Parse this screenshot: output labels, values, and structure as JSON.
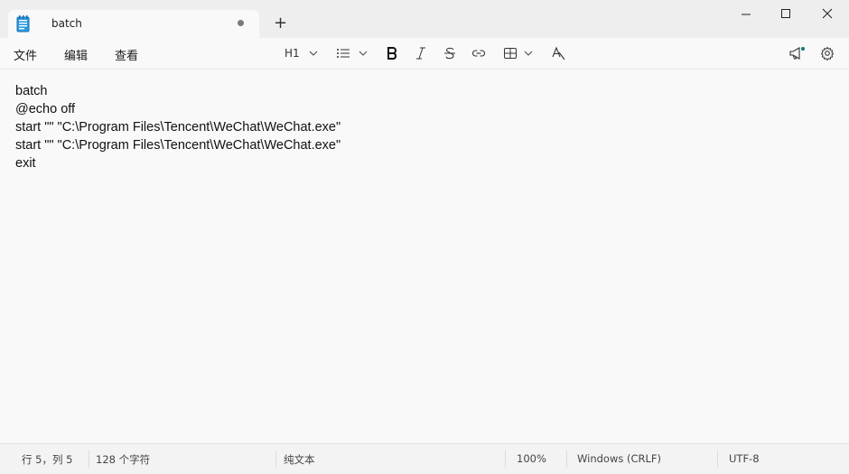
{
  "window": {
    "tab_title": "batch",
    "tab_unsaved": true,
    "new_tab_symbol": "+"
  },
  "menu": {
    "file": "文件",
    "edit": "编辑",
    "view": "查看"
  },
  "toolbar": {
    "heading_label": "H1",
    "icons": [
      "heading-dropdown",
      "list-icon",
      "bold-icon",
      "italic-icon",
      "strikethrough-icon",
      "link-icon",
      "table-icon",
      "clear-format-icon",
      "announcement-icon",
      "settings-icon"
    ]
  },
  "editor": {
    "lines": [
      "batch",
      "@echo off",
      "start \"\" \"C:\\Program Files\\Tencent\\WeChat\\WeChat.exe\"",
      "start \"\" \"C:\\Program Files\\Tencent\\WeChat\\WeChat.exe\"",
      "exit"
    ]
  },
  "status": {
    "position": "行 5，列 5",
    "char_count": "128 个字符",
    "format": "纯文本",
    "zoom": "100%",
    "line_ending": "Windows (CRLF)",
    "encoding": "UTF-8"
  },
  "colors": {
    "accent": "#0f7b6c",
    "notepad_icon": "#1f8fd6"
  }
}
